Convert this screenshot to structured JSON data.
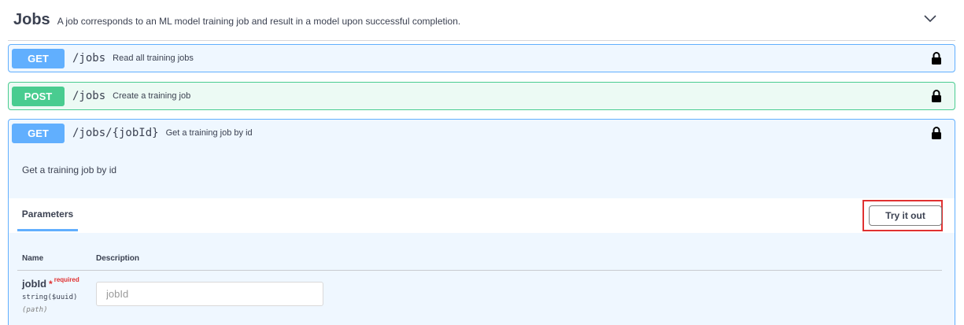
{
  "section": {
    "title": "Jobs",
    "description": "A job corresponds to an ML model training job and result in a model upon successful completion.",
    "toggle_icon": "chevron-down-icon"
  },
  "operations": [
    {
      "method": "GET",
      "path": "/jobs",
      "summary": "Read all training jobs",
      "lock_icon": "lock-icon",
      "color": "#61affe"
    },
    {
      "method": "POST",
      "path": "/jobs",
      "summary": "Create a training job",
      "lock_icon": "lock-icon",
      "color": "#49cc90"
    },
    {
      "method": "GET",
      "path": "/jobs/{jobId}",
      "summary": "Get a training job by id",
      "lock_icon": "lock-icon",
      "color": "#61affe",
      "description": "Get a training job by id"
    }
  ],
  "parameters": {
    "tab_label": "Parameters",
    "try_button_label": "Try it out",
    "columns": {
      "name": "Name",
      "description": "Description"
    },
    "items": [
      {
        "name": "jobId",
        "required_star": "*",
        "required_label": "required",
        "type": "string($uuid)",
        "in": "(path)",
        "placeholder": "jobId",
        "value": ""
      }
    ]
  },
  "colors": {
    "get": "#61affe",
    "post": "#49cc90",
    "highlight": "#e03131"
  }
}
